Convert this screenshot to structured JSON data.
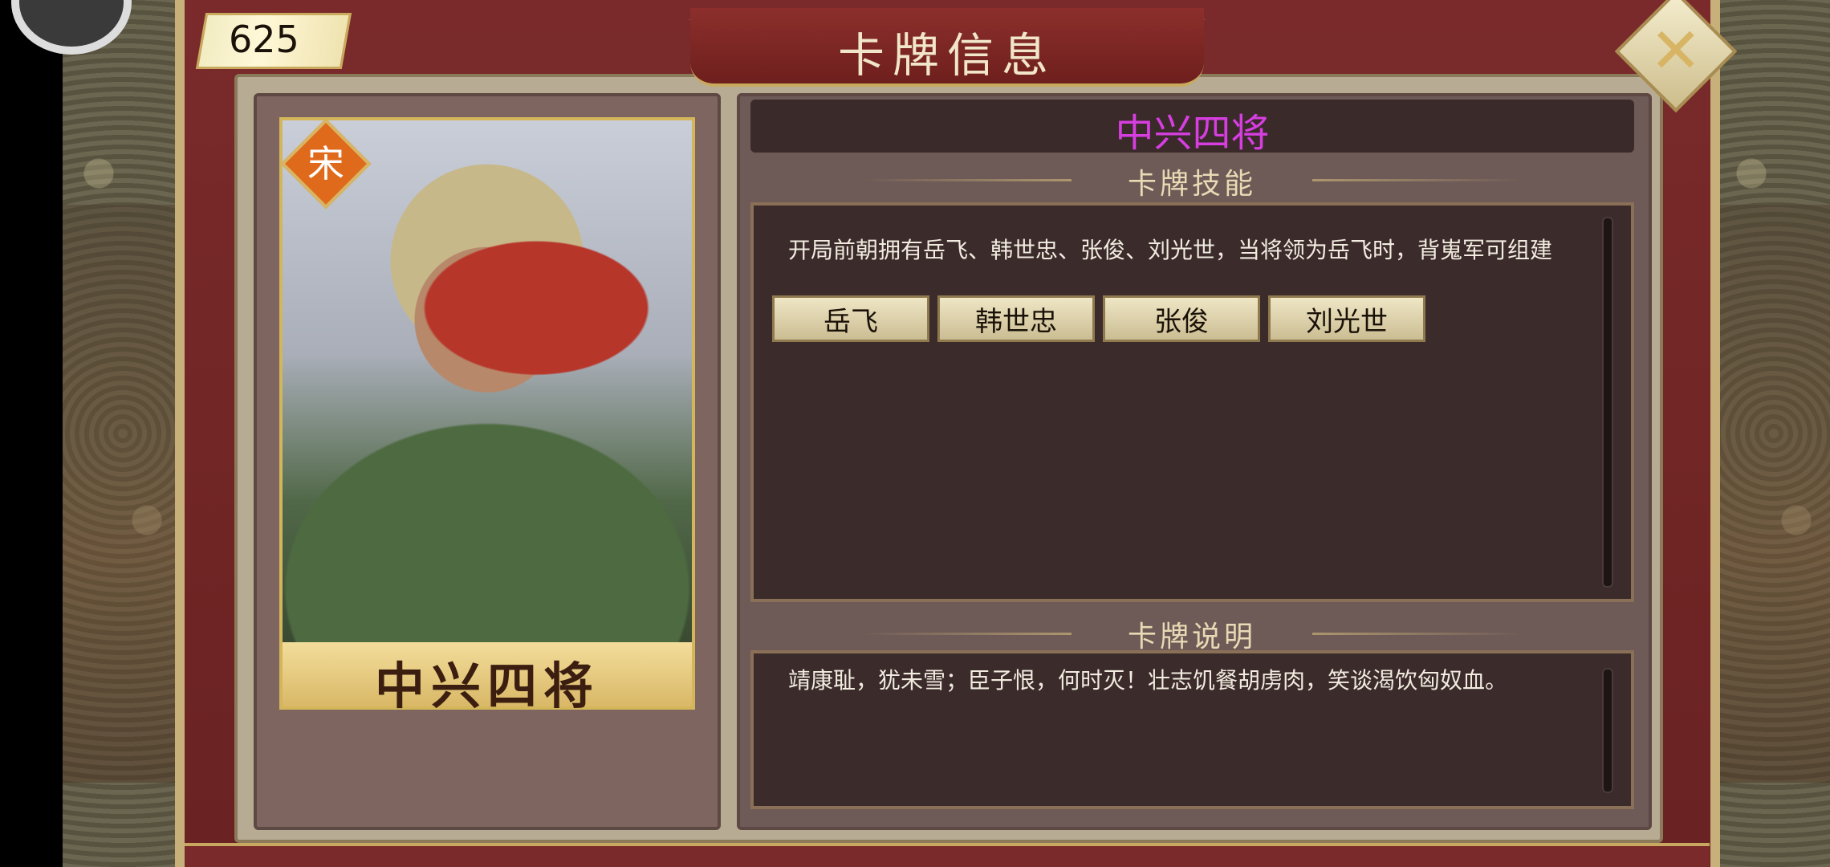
{
  "counter": {
    "value": "625"
  },
  "header": {
    "title": "卡牌信息",
    "close_icon": "close-x-icon"
  },
  "card": {
    "badge": "宋",
    "name_on_card": "中兴四将"
  },
  "info": {
    "card_name": "中兴四将",
    "skill_section_title": "卡牌技能",
    "skill_description": "开局前朝拥有岳飞、韩世忠、张俊、刘光世，当将领为岳飞时，背嵬军可组建",
    "generals": [
      "岳飞",
      "韩世忠",
      "张俊",
      "刘光世"
    ],
    "desc_section_title": "卡牌说明",
    "card_description": "靖康耻，犹未雪；臣子恨，何时灭！壮志饥餐胡虏肉，笑谈渴饮匈奴血。"
  },
  "colors": {
    "name_highlight": "#d63ee0",
    "frame": "#7a2a2a",
    "gold": "#c9a95d"
  }
}
